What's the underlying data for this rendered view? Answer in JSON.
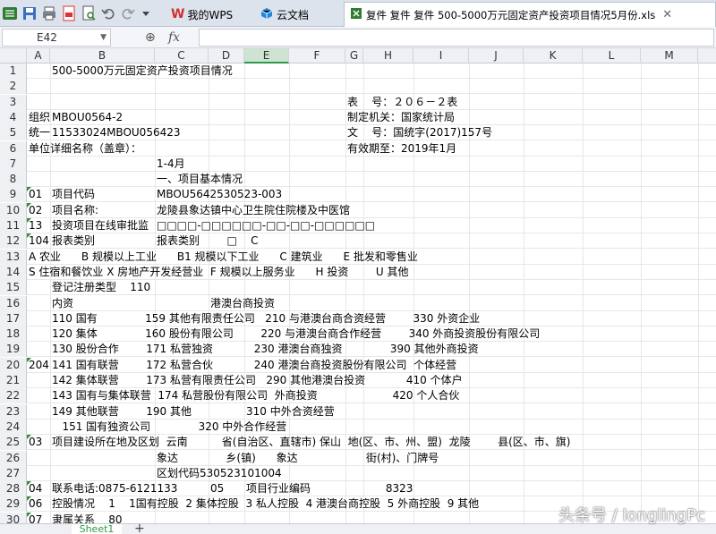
{
  "toolbar": {
    "icons": [
      "app-menu-icon",
      "save-icon",
      "print-icon",
      "export-pdf-icon",
      "print-preview-icon",
      "undo-icon",
      "redo-icon",
      "customize-dropdown-icon"
    ]
  },
  "tabs": [
    {
      "label": "我的WPS",
      "icon": "wps-logo-icon"
    },
    {
      "label": "云文档",
      "icon": "cloud-doc-icon"
    },
    {
      "label": "复件 复件 复件 500-5000万元固定资产投资项目情况5月份.xls",
      "icon": "spreadsheet-icon",
      "active": true
    }
  ],
  "formula_bar": {
    "cell_ref": "E42",
    "zoom_symbol": "⊕",
    "fx_label": "fx",
    "formula": ""
  },
  "columns": [
    "A",
    "B",
    "C",
    "D",
    "E",
    "F",
    "G",
    "H",
    "I",
    "J",
    "K",
    "L",
    "M"
  ],
  "selected_column": "E",
  "rows": [
    {
      "n": "1",
      "cells": [
        {
          "col": "B",
          "text": "500-5000万元固定资产投资项目情况"
        }
      ]
    },
    {
      "n": "2",
      "cells": []
    },
    {
      "n": "3",
      "cells": [
        {
          "col": "G",
          "text": "表    号：２０６－２表"
        }
      ]
    },
    {
      "n": "4",
      "cells": [
        {
          "col": "A",
          "text": "组织"
        },
        {
          "col": "B",
          "text": "MBOU0564-2"
        },
        {
          "col": "G",
          "text": "制定机关：国家统计局"
        }
      ]
    },
    {
      "n": "5",
      "cells": [
        {
          "col": "A",
          "text": "统一"
        },
        {
          "col": "B",
          "text": "11533024MBOU056423"
        },
        {
          "col": "G",
          "text": "文    号：国统字(2017)157号"
        }
      ]
    },
    {
      "n": "6",
      "cells": [
        {
          "col": "A",
          "text": "单位详细名称（盖章）："
        },
        {
          "col": "G",
          "text": "有效期至：2019年1月"
        }
      ]
    },
    {
      "n": "7",
      "cells": [
        {
          "col": "C",
          "text": "1-4月"
        }
      ]
    },
    {
      "n": "8",
      "cells": [
        {
          "col": "C",
          "text": "一、项目基本情况"
        }
      ]
    },
    {
      "n": "9",
      "cells": [
        {
          "col": "A",
          "text": "01"
        },
        {
          "col": "B",
          "text": "项目代码"
        },
        {
          "col": "C",
          "text": "MBOU5642530523-003"
        }
      ]
    },
    {
      "n": "10",
      "cells": [
        {
          "col": "A",
          "text": "02"
        },
        {
          "col": "B",
          "text": "项目名称:"
        },
        {
          "col": "C",
          "text": "龙陵县象达镇中心卫生院住院楼及中医馆"
        }
      ]
    },
    {
      "n": "11",
      "cells": [
        {
          "col": "A",
          "text": "13"
        },
        {
          "col": "B",
          "text": "投资项目在线审批监"
        },
        {
          "col": "C",
          "text": "□□□□-□□□□□□-□□-□□-□□□□□□"
        }
      ]
    },
    {
      "n": "12",
      "cells": [
        {
          "col": "A",
          "text": "104"
        },
        {
          "col": "B",
          "text": "报表类别"
        },
        {
          "col": "C",
          "text": "报表类别        □    C"
        }
      ]
    },
    {
      "n": "13",
      "cells": [
        {
          "col": "A",
          "text": "A 农业      B 规模以上工业      B1 规模以下工业      C 建筑业      E 批发和零售业"
        }
      ]
    },
    {
      "n": "14",
      "cells": [
        {
          "col": "A",
          "text": "S 住宿和餐饮业 X 房地产开发经营业  F 规模以上服务业      H 投资        U 其他"
        }
      ]
    },
    {
      "n": "15",
      "cells": [
        {
          "col": "B",
          "text": "登记注册类型    110"
        }
      ]
    },
    {
      "n": "16",
      "cells": [
        {
          "col": "B",
          "text": "内资"
        },
        {
          "col": "D",
          "text": "港澳台商投资"
        }
      ]
    },
    {
      "n": "17",
      "cells": [
        {
          "col": "B",
          "text": "110 国有              159 其他有限责任公司   210 与港澳台商合资经营        330 外资企业"
        }
      ]
    },
    {
      "n": "18",
      "cells": [
        {
          "col": "B",
          "text": "120 集体              160 股份有限公司        220 与港澳台商合作经营        340 外商投资股份有限公司"
        }
      ]
    },
    {
      "n": "19",
      "cells": [
        {
          "col": "B",
          "text": "130 股份合作        171 私营独资            230 港澳台商独资              390 其他外商投资"
        }
      ]
    },
    {
      "n": "20",
      "cells": [
        {
          "col": "A",
          "text": "204"
        },
        {
          "col": "B",
          "text": "141 国有联营        172 私营合伙            240 港澳台商投资股份有限公司  个体经营"
        }
      ]
    },
    {
      "n": "21",
      "cells": [
        {
          "col": "B",
          "text": "142 集体联营        173 私营有限责任公司   290 其他港澳台投资            410 个体户"
        }
      ]
    },
    {
      "n": "22",
      "cells": [
        {
          "col": "B",
          "text": "143 国有与集体联营  174 私营股份有限公司  外商投资                      420 个人合伙"
        }
      ]
    },
    {
      "n": "23",
      "cells": [
        {
          "col": "B",
          "text": "149 其他联营        190 其他                310 中外合资经营"
        }
      ]
    },
    {
      "n": "24",
      "cells": [
        {
          "col": "B",
          "text": "   151 国有独资公司              320 中外合作经营"
        }
      ]
    },
    {
      "n": "25",
      "cells": [
        {
          "col": "A",
          "text": "03"
        },
        {
          "col": "B",
          "text": "项目建设所在地及区划  云南          省(自治区、直辖市) 保山  地(区、市、州、盟)  龙陵        县(区、市、旗)"
        }
      ]
    },
    {
      "n": "26",
      "cells": [
        {
          "col": "C",
          "text": "象达              乡(镇)      象达                    街(村)、门牌号"
        }
      ]
    },
    {
      "n": "27",
      "cells": [
        {
          "col": "C",
          "text": "区划代码530523101004"
        }
      ]
    },
    {
      "n": "28",
      "cells": [
        {
          "col": "A",
          "text": "04"
        },
        {
          "col": "B",
          "text": "联系电话:0875-6121133"
        },
        {
          "col": "D",
          "text": "05"
        },
        {
          "col": "E",
          "text": "项目行业编码"
        },
        {
          "col": "H",
          "text": "      8323"
        }
      ]
    },
    {
      "n": "29",
      "cells": [
        {
          "col": "A",
          "text": "06"
        },
        {
          "col": "B",
          "text": "控股情况    1    1国有控股  2 集体控股  3 私人控股  4 港澳台商控股  5 外商控股  9 其他"
        }
      ]
    },
    {
      "n": "30",
      "cells": [
        {
          "col": "A",
          "text": "07"
        },
        {
          "col": "B",
          "text": "隶属关系    80"
        }
      ]
    }
  ],
  "sheet_tab": "Sheet1",
  "watermark": "头条号 / longlingPc"
}
